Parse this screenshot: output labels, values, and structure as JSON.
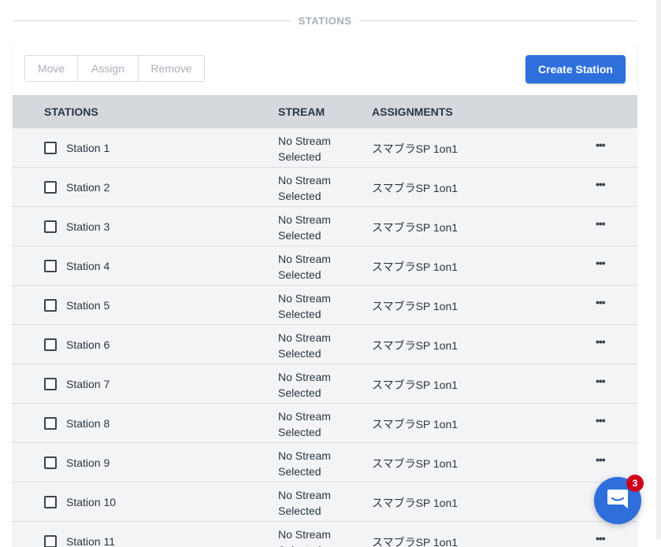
{
  "section": {
    "title": "STATIONS"
  },
  "toolbar": {
    "move_label": "Move",
    "assign_label": "Assign",
    "remove_label": "Remove",
    "create_label": "Create Station"
  },
  "table": {
    "headers": {
      "stations": "STATIONS",
      "stream": "STREAM",
      "assignments": "ASSIGNMENTS"
    },
    "rows": [
      {
        "name": "Station 1",
        "stream_line1": "No Stream",
        "stream_line2": "Selected",
        "assignment": "スマブラSP 1on1",
        "more": "•••"
      },
      {
        "name": "Station 2",
        "stream_line1": "No Stream",
        "stream_line2": "Selected",
        "assignment": "スマブラSP 1on1",
        "more": "•••"
      },
      {
        "name": "Station 3",
        "stream_line1": "No Stream",
        "stream_line2": "Selected",
        "assignment": "スマブラSP 1on1",
        "more": "•••"
      },
      {
        "name": "Station 4",
        "stream_line1": "No Stream",
        "stream_line2": "Selected",
        "assignment": "スマブラSP 1on1",
        "more": "•••"
      },
      {
        "name": "Station 5",
        "stream_line1": "No Stream",
        "stream_line2": "Selected",
        "assignment": "スマブラSP 1on1",
        "more": "•••"
      },
      {
        "name": "Station 6",
        "stream_line1": "No Stream",
        "stream_line2": "Selected",
        "assignment": "スマブラSP 1on1",
        "more": "•••"
      },
      {
        "name": "Station 7",
        "stream_line1": "No Stream",
        "stream_line2": "Selected",
        "assignment": "スマブラSP 1on1",
        "more": "•••"
      },
      {
        "name": "Station 8",
        "stream_line1": "No Stream",
        "stream_line2": "Selected",
        "assignment": "スマブラSP 1on1",
        "more": "•••"
      },
      {
        "name": "Station 9",
        "stream_line1": "No Stream",
        "stream_line2": "Selected",
        "assignment": "スマブラSP 1on1",
        "more": "•••"
      },
      {
        "name": "Station 10",
        "stream_line1": "No Stream",
        "stream_line2": "Selected",
        "assignment": "スマブラSP 1on1",
        "more": "•••"
      },
      {
        "name": "Station 11",
        "stream_line1": "No Stream",
        "stream_line2": "Selected",
        "assignment": "スマブラSP 1on1",
        "more": "•••"
      }
    ]
  },
  "chat": {
    "icon": "chat-bubble-icon",
    "badge_count": "3"
  },
  "colors": {
    "accent": "#2f6fdc",
    "badge": "#d0021b",
    "header_bg": "#d5d9de",
    "row_bg": "#f3f4f6"
  }
}
